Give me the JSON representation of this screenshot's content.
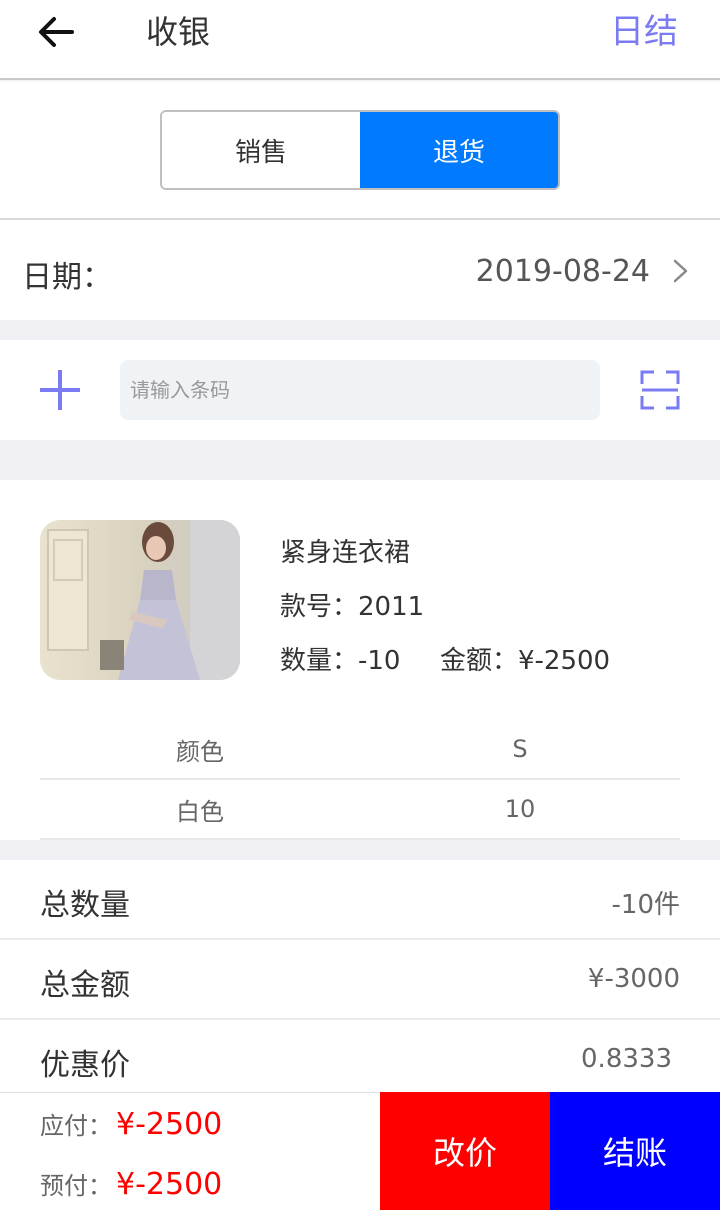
{
  "header": {
    "title": "收银",
    "right_action": "日结",
    "back_icon": "arrow-left-icon"
  },
  "segment": {
    "options": [
      "销售",
      "退货"
    ],
    "selected": "退货"
  },
  "date": {
    "label": "日期：",
    "value": "2019-08-24"
  },
  "scan": {
    "placeholder": "请输入条码",
    "add_icon": "plus-icon",
    "scan_icon": "scan-frame-icon"
  },
  "product": {
    "name": "紧身连衣裙",
    "style_no": "款号：2011",
    "quantity": "数量：-10",
    "amount": "金额：¥-2500",
    "spec_header": [
      "颜色",
      "S"
    ],
    "spec_rows": [
      [
        "白色",
        "10"
      ]
    ]
  },
  "summary": {
    "total_qty_label": "总数量",
    "total_qty_value": "-10件",
    "total_amt_label": "总金额",
    "total_amt_value": "¥-3000",
    "discount_label": "优惠价",
    "discount_value": "0.8333"
  },
  "footer": {
    "payable_label": "应付：",
    "payable_value": "¥-2500",
    "prepaid_label": "预付：",
    "prepaid_value": "¥-2500",
    "change_price": "改价",
    "checkout": "结账"
  },
  "colors": {
    "accent_purple": "#7b7cf3",
    "segment_active": "#007aff",
    "price_red": "#ff0000",
    "change_btn": "#ff0000",
    "checkout_btn": "#0000ff",
    "section_gap": "#efeff4"
  }
}
